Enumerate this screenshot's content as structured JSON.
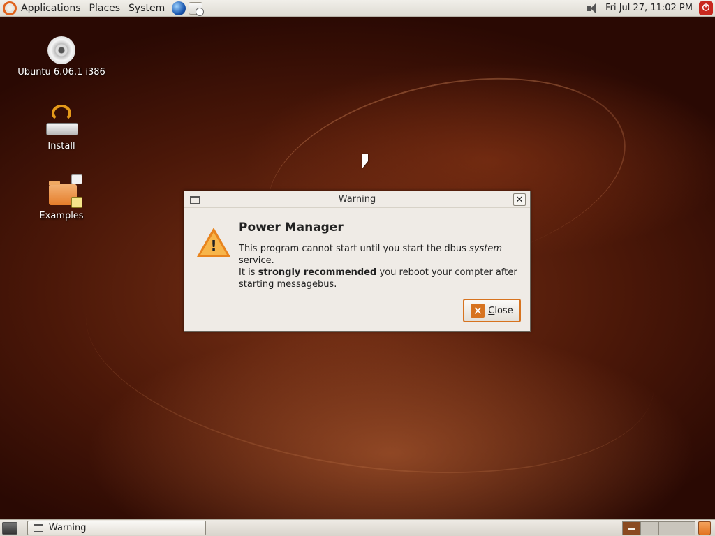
{
  "top_panel": {
    "menus": [
      "Applications",
      "Places",
      "System"
    ],
    "clock": "Fri Jul 27, 11:02 PM",
    "icons": [
      "ubuntu-logo-icon",
      "globe-icon",
      "mail-icon",
      "volume-icon",
      "power-icon"
    ]
  },
  "desktop": {
    "icons": [
      {
        "label": "Ubuntu 6.06.1 i386",
        "icon": "cd-icon"
      },
      {
        "label": "Install",
        "icon": "install-icon"
      },
      {
        "label": "Examples",
        "icon": "folder-icon"
      }
    ]
  },
  "dialog": {
    "title": "Warning",
    "heading": "Power Manager",
    "line1_a": "This program cannot start until you start the dbus ",
    "line1_em": "system",
    "line1_b": " service.",
    "line2_a": "It is ",
    "line2_strong": "strongly recommended",
    "line2_b": " you reboot your compter after starting messagebus.",
    "close_button_mnemonic": "C",
    "close_button_rest": "lose",
    "icon": "warning-icon"
  },
  "bottom_panel": {
    "task_label": "Warning",
    "workspace_count": 4,
    "active_workspace": 1
  },
  "colors": {
    "accent": "#d7731f",
    "desktop_dark": "#2a0903",
    "desktop_mid": "#7a3216"
  }
}
